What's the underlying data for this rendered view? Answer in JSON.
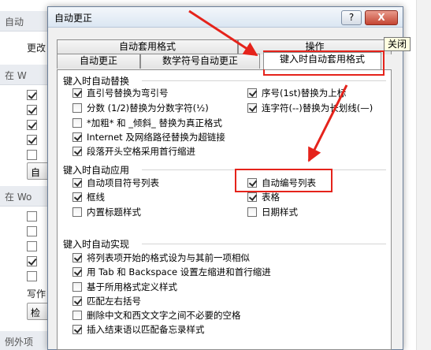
{
  "background": {
    "section_header_1": "自动",
    "more_label": "更改",
    "section_header_2": "在 W",
    "btn_1": "自",
    "section_header_3": "在 Wo",
    "write_label": "写作",
    "btn_2": "检",
    "section_header_4": "例外项",
    "checks_top": [
      true,
      true,
      true,
      true,
      false
    ],
    "checks_bottom": [
      false,
      false,
      false,
      true,
      false
    ]
  },
  "dialog": {
    "title": "自动更正",
    "help_label": "?",
    "close_label": "X",
    "tooltip": "关闭",
    "tabs_back": [
      "自动套用格式",
      "操作"
    ],
    "tabs_front": [
      "自动更正",
      "数学符号自动更正",
      "键入时自动套用格式"
    ],
    "groups": [
      {
        "title": "键入时自动替换",
        "items": [
          {
            "label": "直引号替换为弯引号",
            "checked": true
          },
          {
            "label": "分数 (1/2)替换为分数字符(½)",
            "checked": false
          },
          {
            "label": "*加粗* 和 _倾斜_ 替换为真正格式",
            "checked": false
          },
          {
            "label": "Internet 及网络路径替换为超链接",
            "checked": true
          },
          {
            "label": "段落开头空格采用首行缩进",
            "checked": true
          },
          {
            "label": "序号(1st)替换为上标",
            "checked": true
          },
          {
            "label": "连字符(--)替换为长划线(—)",
            "checked": true
          }
        ]
      },
      {
        "title": "键入时自动应用",
        "items": [
          {
            "label": "自动项目符号列表",
            "checked": true
          },
          {
            "label": "框线",
            "checked": true
          },
          {
            "label": "内置标题样式",
            "checked": false
          },
          {
            "label": "自动编号列表",
            "checked": true
          },
          {
            "label": "表格",
            "checked": true
          },
          {
            "label": "日期样式",
            "checked": false
          }
        ]
      },
      {
        "title": "键入时自动实现",
        "items": [
          {
            "label": "将列表项开始的格式设为与其前一项相似",
            "checked": true
          },
          {
            "label": "用 Tab 和 Backspace 设置左缩进和首行缩进",
            "checked": true
          },
          {
            "label": "基于所用格式定义样式",
            "checked": false
          },
          {
            "label": "匹配左右括号",
            "checked": true
          },
          {
            "label": "删除中文和西文文字之间不必要的空格",
            "checked": false
          },
          {
            "label": "插入结束语以匹配备忘录样式",
            "checked": true
          }
        ]
      }
    ]
  },
  "colors": {
    "annotation": "#e5231b",
    "titlebar": "#dbe6f2",
    "close": "#c44533"
  }
}
